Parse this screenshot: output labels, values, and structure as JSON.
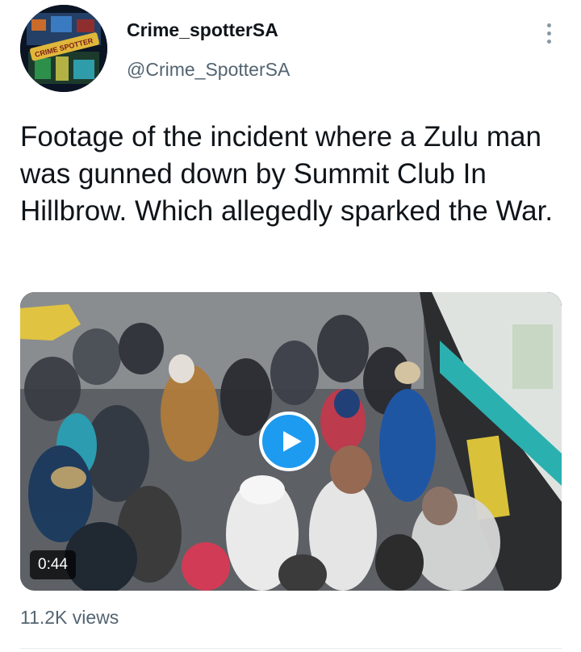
{
  "author": {
    "display_name": "Crime_spotterSA",
    "handle": "@Crime_SpotterSA",
    "avatar_logo_text": "CRIME SPOTTER"
  },
  "menu": {
    "icon": "more-vertical-icon"
  },
  "tweet": {
    "text": "Footage of the incident where a Zulu man was gunned down by Summit Club In Hillbrow. Which allegedly sparked the War."
  },
  "media": {
    "type": "video",
    "duration": "0:44",
    "play_icon": "play-icon"
  },
  "stats": {
    "views": "11.2K views"
  },
  "colors": {
    "accent": "#1d9bf0",
    "text_primary": "#0f1419",
    "text_secondary": "#536471"
  }
}
